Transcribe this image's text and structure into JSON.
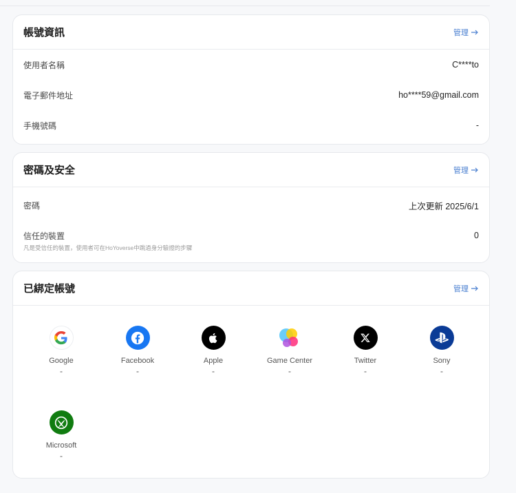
{
  "account": {
    "title": "帳號資訊",
    "manage": "管理",
    "rows": [
      {
        "label": "使用者名稱",
        "value": "C****to"
      },
      {
        "label": "電子郵件地址",
        "value": "ho****59@gmail.com"
      },
      {
        "label": "手機號碼",
        "value": "-"
      }
    ]
  },
  "security": {
    "title": "密碼及安全",
    "manage": "管理",
    "password_label": "密碼",
    "password_value": "上次更新 2025/6/1",
    "devices_label": "信任的裝置",
    "devices_value": "0",
    "devices_note": "凡是受信任的裝置，使用者可在HoYoverse中跳過身分驗證的步驟"
  },
  "linked": {
    "title": "已綁定帳號",
    "manage": "管理",
    "accounts": [
      {
        "name": "Google",
        "status": "-",
        "icon": "google-icon"
      },
      {
        "name": "Facebook",
        "status": "-",
        "icon": "facebook-icon"
      },
      {
        "name": "Apple",
        "status": "-",
        "icon": "apple-icon"
      },
      {
        "name": "Game Center",
        "status": "-",
        "icon": "game-center-icon"
      },
      {
        "name": "Twitter",
        "status": "-",
        "icon": "x-icon"
      },
      {
        "name": "Sony",
        "status": "-",
        "icon": "playstation-icon"
      },
      {
        "name": "Microsoft",
        "status": "-",
        "icon": "xbox-icon"
      }
    ]
  },
  "colors": {
    "accent": "#4a7fd0",
    "facebook": "#1877f2",
    "apple": "#000000",
    "twitter": "#000000",
    "sony": "#0a3b96",
    "microsoft": "#107c10"
  }
}
